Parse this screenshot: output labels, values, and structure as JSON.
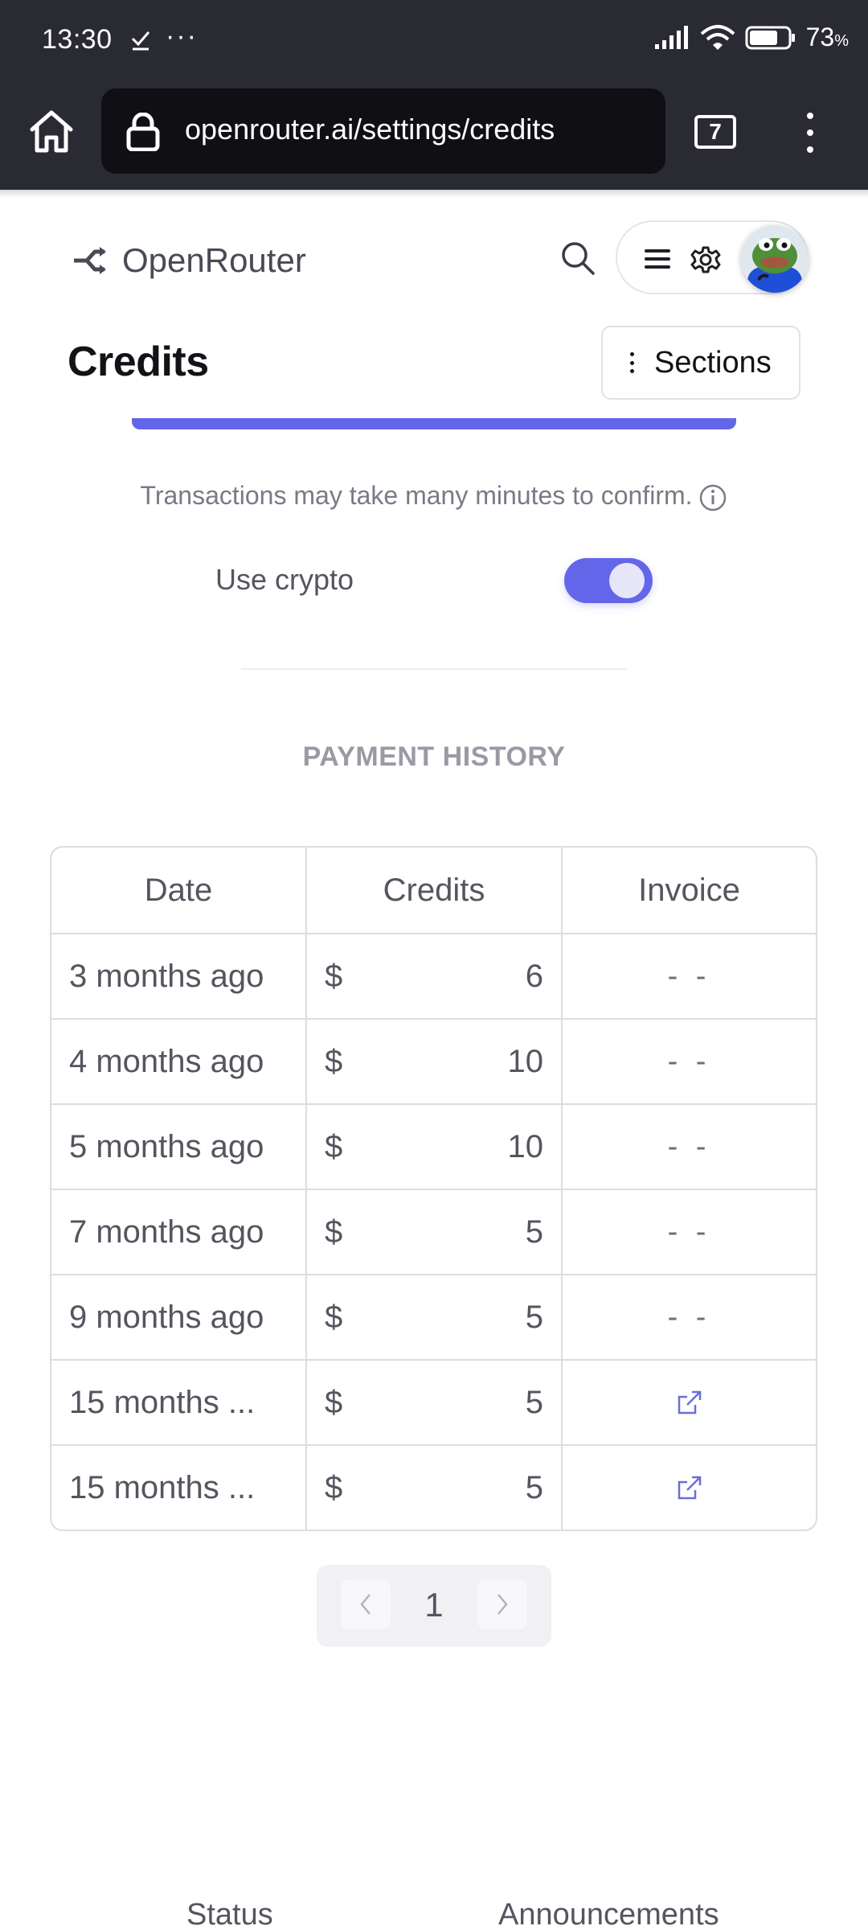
{
  "status_bar": {
    "time": "13:30",
    "battery_percent": "73",
    "battery_symbol": "%",
    "battery_level": 0.73
  },
  "browser": {
    "url": "openrouter.ai/settings/credits",
    "tab_count": "7"
  },
  "header": {
    "brand": "OpenRouter"
  },
  "page": {
    "title": "Credits",
    "sections_label": "Sections",
    "transactions_note": "Transactions may take many minutes to confirm.",
    "crypto_label": "Use crypto",
    "crypto_enabled": true,
    "accent_color": "#6466e9"
  },
  "payment_history": {
    "heading": "PAYMENT HISTORY",
    "columns": [
      "Date",
      "Credits",
      "Invoice"
    ],
    "currency_symbol": "$",
    "rows": [
      {
        "date": "3 months ago",
        "amount": "6",
        "invoice": "- -"
      },
      {
        "date": "4 months ago",
        "amount": "10",
        "invoice": "- -"
      },
      {
        "date": "5 months ago",
        "amount": "10",
        "invoice": "- -"
      },
      {
        "date": "7 months ago",
        "amount": "5",
        "invoice": "- -"
      },
      {
        "date": "9 months ago",
        "amount": "5",
        "invoice": "- -"
      },
      {
        "date": "15 months ...",
        "amount": "5",
        "invoice": "external-link-icon"
      },
      {
        "date": "15 months ...",
        "amount": "5",
        "invoice": "external-link-icon"
      }
    ]
  },
  "pagination": {
    "current_page": "1"
  },
  "footer": {
    "links": [
      "Status",
      "Announcements"
    ]
  }
}
